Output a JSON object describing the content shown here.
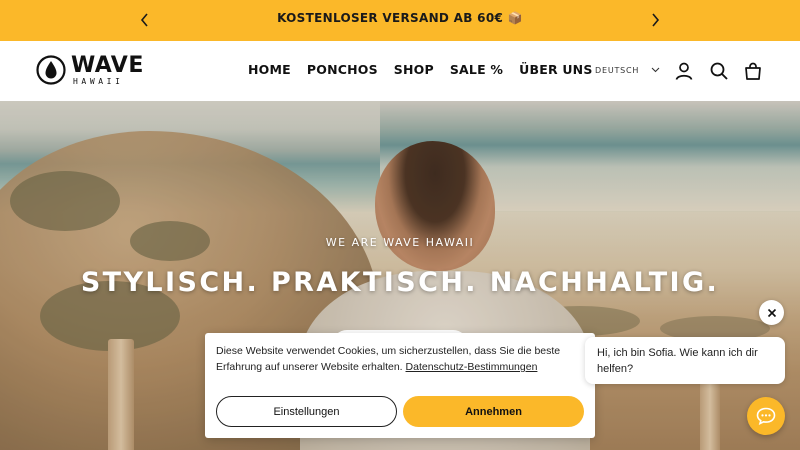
{
  "announcement": {
    "text": "KOSTENLOSER VERSAND AB 60€ 📦",
    "prev_icon": "chevron-left-icon",
    "next_icon": "chevron-right-icon",
    "background": "#fbb829"
  },
  "header": {
    "logo": {
      "wordmark": "WAVE",
      "subline": "HAWAII"
    },
    "nav": [
      {
        "label": "HOME"
      },
      {
        "label": "PONCHOS"
      },
      {
        "label": "SHOP"
      },
      {
        "label": "SALE %"
      },
      {
        "label": "ÜBER UNS"
      }
    ],
    "language": "DEUTSCH",
    "icons": [
      "account-icon",
      "search-icon",
      "cart-icon"
    ]
  },
  "hero": {
    "eyebrow": "WE ARE WAVE HAWAII",
    "headline": "STYLISCH. PRAKTISCH. NACHHALTIG."
  },
  "cookie_banner": {
    "message": "Diese Website verwendet Cookies, um sicherzustellen, dass Sie die beste Erfahrung auf unserer Website erhalten.",
    "link_text": "Datenschutz-Bestimmungen",
    "settings_label": "Einstellungen",
    "accept_label": "Annehmen"
  },
  "chat": {
    "greeting": "Hi, ich bin Sofia. Wie kann ich dir helfen?",
    "close_icon": "close-icon",
    "launcher_icon": "chat-icon"
  },
  "colors": {
    "accent": "#fbb829",
    "text": "#111111"
  }
}
